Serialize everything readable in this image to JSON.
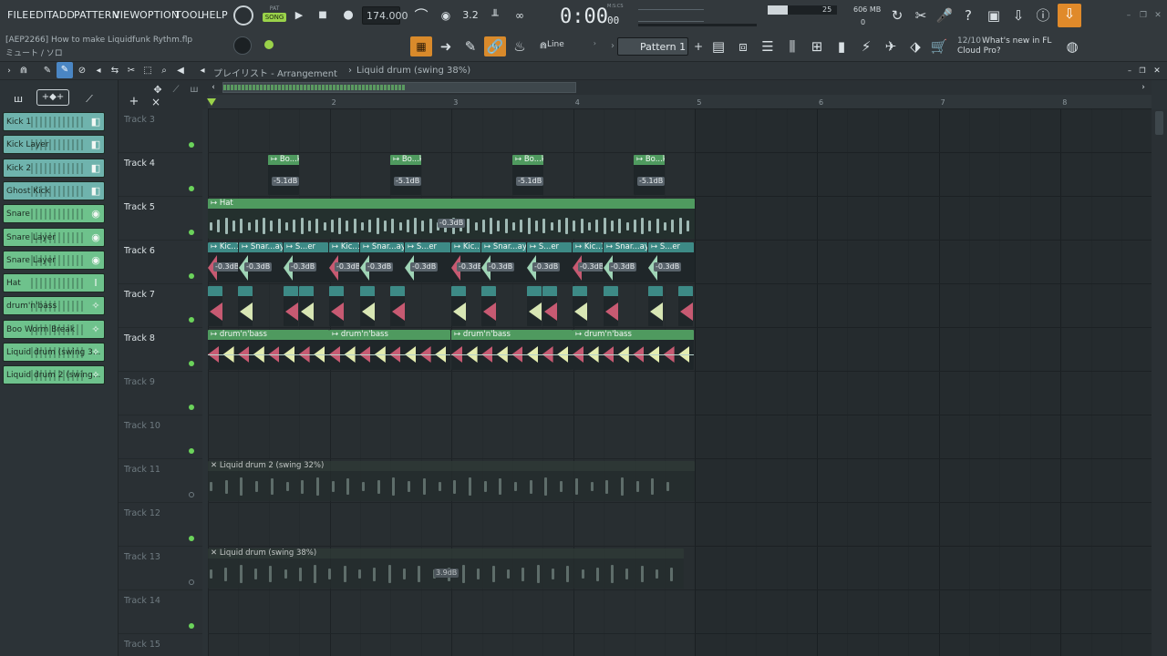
{
  "menu": [
    "FILE",
    "EDIT",
    "ADD",
    "PATTERN",
    "VIEW",
    "OPTION",
    "TOOL",
    "HELP"
  ],
  "transport": {
    "pat": "PAT",
    "song": "SONG",
    "tempo": "174.000",
    "time": "0:00",
    "time_small": "00",
    "time_unit": "M:S:CS"
  },
  "meters": {
    "cpu": "25",
    "mem": "606 MB",
    "voices": "0"
  },
  "project": {
    "file": "[AEP2266] How to make Liquidfunk Rythm.flp",
    "sub": "ミュート / ソロ"
  },
  "snap": {
    "mode": "Line"
  },
  "pattern": {
    "name": "Pattern 1"
  },
  "news": {
    "date": "12/10",
    "line1": "What's new in FL",
    "line2": "Cloud Pro?"
  },
  "playlist": {
    "title": "プレイリスト - Arrangement",
    "sep": "›",
    "clip": "Liquid drum (swing 38%)"
  },
  "ruler": [
    "2",
    "3",
    "4",
    "5",
    "6",
    "7",
    "8"
  ],
  "channels": [
    {
      "label": "Kick 1",
      "color": "#6fb3ad"
    },
    {
      "label": "Kick Layer",
      "color": "#6fb3ad"
    },
    {
      "label": "Kick 2",
      "color": "#6fb3ad"
    },
    {
      "label": "Ghost Kick",
      "color": "#6fb3ad"
    },
    {
      "label": "Snare",
      "color": "#6ec28c"
    },
    {
      "label": "Snare Layer",
      "color": "#6ec28c"
    },
    {
      "label": "Snare Layer",
      "color": "#6ec28c"
    },
    {
      "label": "Hat",
      "color": "#6ec28c"
    },
    {
      "label": "drum'n'bass",
      "color": "#6ec28c"
    },
    {
      "label": "Boo Worm Break",
      "color": "#6ec28c"
    },
    {
      "label": "Liquid drum (swing 3...",
      "color": "#6ec28c"
    },
    {
      "label": "Liquid drum 2 (swing...",
      "color": "#6ec28c"
    }
  ],
  "tracks": [
    "Track 3",
    "Track 4",
    "Track 5",
    "Track 6",
    "Track 7",
    "Track 8",
    "Track 9",
    "Track 10",
    "Track 11",
    "Track 12",
    "Track 13",
    "Track 14",
    "Track 15"
  ],
  "clips": {
    "t4": {
      "label": "Bo...k",
      "vol": "-5.1dB"
    },
    "t5": {
      "label": "Hat",
      "vol": "-0.3dB"
    },
    "t6": {
      "labels": [
        "Kic..1",
        "Snar...ayer",
        "S...er"
      ],
      "vol": "-0.3dB"
    },
    "t8": {
      "label": "drum'n'bass"
    },
    "t11": {
      "label": "Liquid drum 2 (swing 32%)"
    },
    "t13": {
      "label": "Liquid drum (swing 38%)",
      "vol": "3.9dB"
    }
  },
  "colors": {
    "green": "#4f9a5f",
    "teal": "#3d8a86",
    "pink": "#c75a72"
  }
}
